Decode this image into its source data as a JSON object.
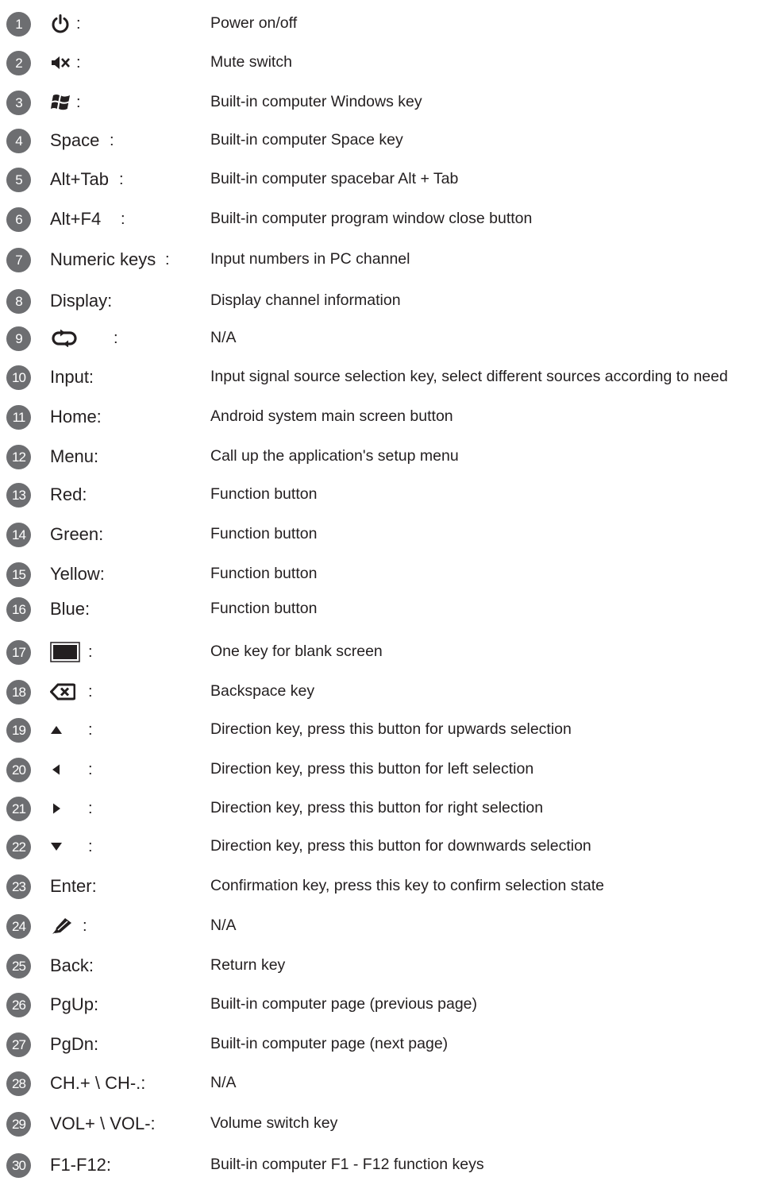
{
  "rows": [
    {
      "n": "1",
      "key": "",
      "icon": "power-icon",
      "colon": ":",
      "desc": "Power on/off"
    },
    {
      "n": "2",
      "key": "",
      "icon": "mute-icon",
      "colon": ":",
      "desc": "Mute switch"
    },
    {
      "n": "3",
      "key": "",
      "icon": "windows-icon",
      "colon": ":",
      "desc": "Built-in computer Windows key"
    },
    {
      "n": "4",
      "key": "Space",
      "icon": "",
      "colon": ":",
      "desc": "Built-in computer Space key"
    },
    {
      "n": "5",
      "key": "Alt+Tab",
      "icon": "",
      "colon": ":",
      "desc": "Built-in computer spacebar Alt + Tab"
    },
    {
      "n": "6",
      "key": "Alt+F4",
      "icon": "",
      "colon": ":",
      "desc": "Built-in computer program window close button"
    },
    {
      "n": "7",
      "key": "Numeric keys",
      "icon": "",
      "colon": ":",
      "desc": "Input numbers in PC channel"
    },
    {
      "n": "8",
      "key": "Display:",
      "icon": "",
      "colon": "",
      "desc": "Display channel information"
    },
    {
      "n": "9",
      "key": "",
      "icon": "loop-icon",
      "colon": ":",
      "desc": "N/A"
    },
    {
      "n": "10",
      "key": "Input:",
      "icon": "",
      "colon": "",
      "desc": "Input signal source selection key, select different sources according to need"
    },
    {
      "n": "11",
      "key": "Home:",
      "icon": "",
      "colon": "",
      "desc": "Android system main screen button"
    },
    {
      "n": "12",
      "key": "Menu:",
      "icon": "",
      "colon": "",
      "desc": "Call up the application's setup menu"
    },
    {
      "n": "13",
      "key": "Red:",
      "icon": "",
      "colon": "",
      "desc": "Function button"
    },
    {
      "n": "14",
      "key": "Green:",
      "icon": "",
      "colon": "",
      "desc": "Function button"
    },
    {
      "n": "15",
      "key": "Yellow:",
      "icon": "",
      "colon": "",
      "desc": "Function button"
    },
    {
      "n": "16",
      "key": "Blue:",
      "icon": "",
      "colon": "",
      "desc": "Function button"
    },
    {
      "n": "17",
      "key": "",
      "icon": "blank-screen-icon",
      "colon": ":",
      "desc": "One key for blank screen"
    },
    {
      "n": "18",
      "key": "",
      "icon": "backspace-icon",
      "colon": ":",
      "desc": "Backspace key"
    },
    {
      "n": "19",
      "key": "",
      "icon": "arrow-up-icon",
      "colon": ":",
      "desc": "Direction key, press this button for upwards selection"
    },
    {
      "n": "20",
      "key": "",
      "icon": "arrow-left-icon",
      "colon": ":",
      "desc": "Direction key, press this button for left selection"
    },
    {
      "n": "21",
      "key": "",
      "icon": "arrow-right-icon",
      "colon": ":",
      "desc": "Direction key, press this button for right selection"
    },
    {
      "n": "22",
      "key": "",
      "icon": "arrow-down-icon",
      "colon": ":",
      "desc": "Direction key, press this button for downwards selection"
    },
    {
      "n": "23",
      "key": "Enter:",
      "icon": "",
      "colon": "",
      "desc": "Confirmation key, press this key to confirm selection state"
    },
    {
      "n": "24",
      "key": "",
      "icon": "pen-icon",
      "colon": ":",
      "desc": "N/A"
    },
    {
      "n": "25",
      "key": "Back:",
      "icon": "",
      "colon": "",
      "desc": "Return key"
    },
    {
      "n": "26",
      "key": "PgUp:",
      "icon": "",
      "colon": "",
      "desc": "Built-in computer page (previous page)"
    },
    {
      "n": "27",
      "key": "PgDn:",
      "icon": "",
      "colon": "",
      "desc": "Built-in computer page (next page)"
    },
    {
      "n": "28",
      "key": "CH.+ \\ CH-.:",
      "icon": "",
      "colon": "",
      "desc": "N/A"
    },
    {
      "n": "29",
      "key": "VOL+ \\ VOL-:",
      "icon": "",
      "colon": "",
      "desc": "Volume switch key"
    },
    {
      "n": "30",
      "key": "F1-F12:",
      "icon": "",
      "colon": "",
      "desc": "Built-in computer F1 - F12 function keys"
    }
  ]
}
